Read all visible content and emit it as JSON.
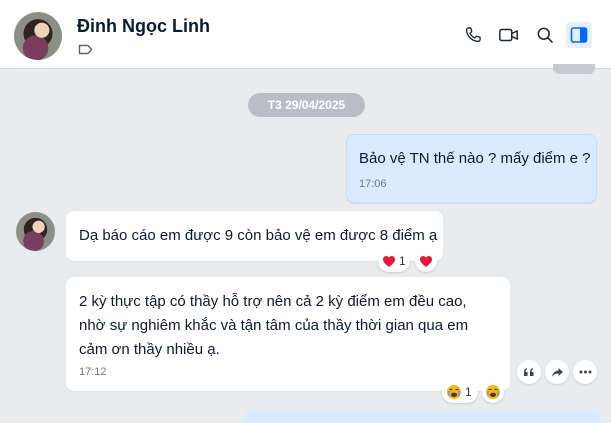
{
  "header": {
    "contact_name": "Đinh Ngọc Linh",
    "icons": [
      "tag-icon",
      "phone-icon",
      "video-icon",
      "search-icon",
      "sidebar-toggle-icon"
    ],
    "accent_color": "#0068ff"
  },
  "conversation": {
    "date_separator": "T3 29/04/2025",
    "messages": [
      {
        "sender": "me",
        "text": "Bảo vệ TN thế nào ? mấy điểm e ?",
        "time": "17:06"
      },
      {
        "sender": "contact",
        "text": "Dạ báo cáo em được 9 còn bảo vệ em được 8 điểm ạ",
        "reaction": {
          "emoji": "heart",
          "count": "1"
        }
      },
      {
        "sender": "contact",
        "lines": [
          "2 kỳ thực tập có thầy hỗ trợ nên cả 2 kỳ điểm em đều cao,",
          "nhờ sự nghiêm khắc và tận tâm của thầy thời gian qua em",
          "cảm ơn thầy nhiều ạ."
        ],
        "time": "17:12",
        "reaction": {
          "emoji": "crying-face",
          "count": "1"
        }
      }
    ]
  },
  "message_actions": [
    "quote-icon",
    "forward-icon",
    "more-icon"
  ]
}
